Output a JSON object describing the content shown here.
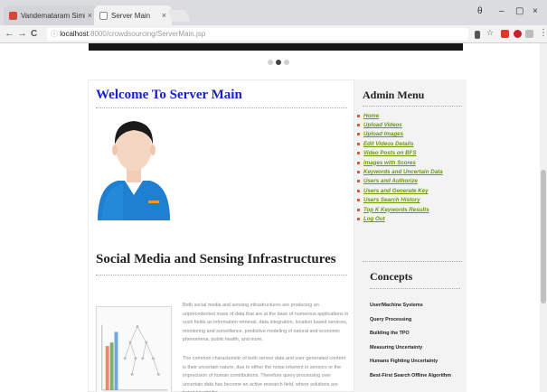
{
  "browser": {
    "tabs": [
      {
        "label": "Vandemataram Simil",
        "close": "×"
      },
      {
        "label": "Server Main",
        "close": "×"
      }
    ],
    "window_controls": [
      "θ",
      "–",
      "▢",
      "×"
    ],
    "nav": {
      "back": "←",
      "forward": "→",
      "reload": "C",
      "info": "ⓘ"
    },
    "url": {
      "host": "localhost",
      "rest": ":8000/crowdsourcing/ServerMain.jsp"
    },
    "toolbar_icons": [
      "funnel-icon",
      "star-icon",
      "ext-red-icon",
      "ext-opera-icon",
      "ext-grey-icon"
    ],
    "menu_glyph": "⋮"
  },
  "page": {
    "carousel_dots": 3,
    "carousel_active": 1,
    "main": {
      "title": "Welcome To Server Main",
      "section_title": "Social Media and Sensing Infrastructures",
      "paragraphs": [
        "Both social media and sensing infrastructures are producing an unprecedented mass of data that are at the base of numerous applications in such fields as information retrieval, data integration, location based services, monitoring and surveillance, predictive modeling of natural and economic phenomena, public health, and more.",
        "The common characteristic of both sensor data and user-generated content is their uncertain nature, due to either the noise inherent in sensors or the imprecision of human contributions. Therefore query processing over uncertain data has become an active research field, where solutions are being sought for"
      ]
    },
    "sidebar": {
      "menu_title": "Admin Menu",
      "menu_items": [
        "Home",
        "Upload Videos",
        "Upload Images",
        "Edit Videos Details",
        "Video Posts on BFS",
        "Images with Scores",
        "Keywords and Uncertain Data",
        "Users and Authorize",
        "Users and Generate Key",
        "Users Search History",
        "Top K Keywords Results",
        "Log Out"
      ],
      "concepts_title": "Concepts",
      "concepts": [
        "User/Machine Systems",
        "Query Processing",
        "Building the TPO",
        "Measuring Uncertainty",
        "Humans Fighting Uncertainty",
        "Best-First Search Offline Algorithm"
      ]
    }
  },
  "colors": {
    "title_blue": "#1a20c8",
    "menu_green": "#6b9a00",
    "bullet": "#e05a2b"
  }
}
